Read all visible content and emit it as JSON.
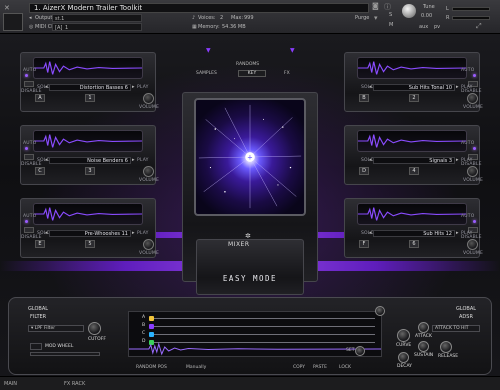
{
  "header": {
    "instrument_title": "1. AizerX Modern Trailer Toolkit",
    "output_label": "Output",
    "output_value": "st.1",
    "midi_label": "MIDI Ch:",
    "midi_port": "[A]",
    "midi_channel": "1",
    "voices_label": "Voices:",
    "voices_value": "2",
    "max_label": "Max:",
    "max_value": "999",
    "memory_label": "Memory:",
    "memory_value": "54.36 MB",
    "purge_label": "Purge",
    "tune_label": "Tune",
    "tune_value": "0.00",
    "aux_label": "aux",
    "pv_label": "pv",
    "s_label": "S",
    "m_label": "M",
    "l_label": "L",
    "r_label": "R",
    "meter_levels": [
      0.0,
      0.0
    ]
  },
  "center": {
    "tab_left": "SAMPLES",
    "tab_right": "FX",
    "randoms_label": "RANDOMS",
    "randoms_value": "KEY",
    "mixer_label": "MIXER",
    "mode_label": "EASY MODE"
  },
  "slots": [
    {
      "id": "1",
      "name": "Distortion Basses 6",
      "key": "A",
      "disable": "DISABLE",
      "solo": "SOLO",
      "play": "PLAY",
      "volume": "VOLUME",
      "auto": "AUTO",
      "side": "left"
    },
    {
      "id": "2",
      "name": "Sub Hits Tonal 10",
      "key": "B",
      "disable": "DISABLE",
      "solo": "SOLO",
      "play": "PLAY",
      "volume": "VOLUME",
      "auto": "AUTO",
      "side": "right"
    },
    {
      "id": "3",
      "name": "Noise Benders 6",
      "key": "C",
      "disable": "DISABLE",
      "solo": "SOLO",
      "play": "PLAY",
      "volume": "VOLUME",
      "auto": "AUTO",
      "side": "left"
    },
    {
      "id": "4",
      "name": "Signals 3",
      "key": "D",
      "disable": "DISABLE",
      "solo": "SOLO",
      "play": "PLAY",
      "volume": "VOLUME",
      "auto": "AUTO",
      "side": "right"
    },
    {
      "id": "5",
      "name": "Pre-Whooshes 11",
      "key": "E",
      "disable": "DISABLE",
      "solo": "SOLO",
      "play": "PLAY",
      "volume": "VOLUME",
      "auto": "AUTO",
      "side": "left"
    },
    {
      "id": "6",
      "name": "Sub Hits 12",
      "key": "F",
      "disable": "DISABLE",
      "solo": "SOLO",
      "play": "PLAY",
      "volume": "VOLUME",
      "auto": "AUTO",
      "side": "right"
    }
  ],
  "bottom": {
    "global_filter_title_1": "GLOBAL",
    "global_filter_title_2": "FILTER",
    "filter_type": "LPF Filter",
    "cutoff_label": "CUTOFF",
    "mod_wheel_label": "MOD WHEEL",
    "seq_letters": [
      "A",
      "B",
      "C",
      "D"
    ],
    "random_pos_label": "RANDOM POS",
    "mode_value": "Manually",
    "copy_label": "COPY",
    "paste_label": "PASTE",
    "lock_label": "LOCK",
    "set_label": "SET",
    "adsr_title_1": "GLOBAL",
    "adsr_title_2": "ADSR",
    "attack_to_hit": "ATTACK TO HIT",
    "curve_label": "CURVE",
    "attack_label": "ATTACK",
    "decay_label": "DECAY",
    "sustain_label": "SUSTAIN",
    "release_label": "RELEASE"
  },
  "footer": {
    "left": "MAIN",
    "mid": "FX RACK"
  },
  "colors": {
    "accent": "#8a3cff",
    "seq_a": "#f0c33a",
    "seq_b": "#8a3cff",
    "seq_c": "#2ab3ff",
    "seq_d": "#3ad15a"
  }
}
